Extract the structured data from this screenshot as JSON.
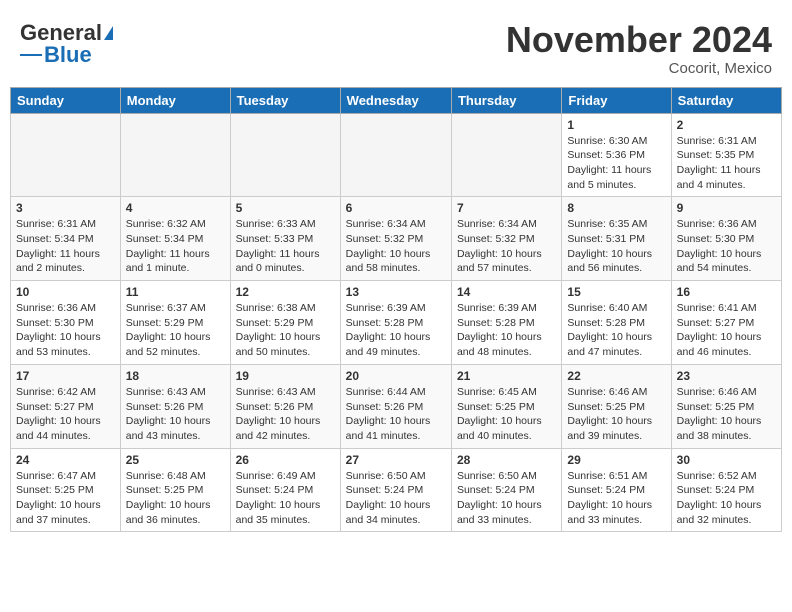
{
  "header": {
    "logo_general": "General",
    "logo_blue": "Blue",
    "month_title": "November 2024",
    "location": "Cocorit, Mexico"
  },
  "weekdays": [
    "Sunday",
    "Monday",
    "Tuesday",
    "Wednesday",
    "Thursday",
    "Friday",
    "Saturday"
  ],
  "weeks": [
    [
      {
        "day": "",
        "empty": true
      },
      {
        "day": "",
        "empty": true
      },
      {
        "day": "",
        "empty": true
      },
      {
        "day": "",
        "empty": true
      },
      {
        "day": "",
        "empty": true
      },
      {
        "day": "1",
        "sunrise": "6:30 AM",
        "sunset": "5:36 PM",
        "daylight": "11 hours and 5 minutes."
      },
      {
        "day": "2",
        "sunrise": "6:31 AM",
        "sunset": "5:35 PM",
        "daylight": "11 hours and 4 minutes."
      }
    ],
    [
      {
        "day": "3",
        "sunrise": "6:31 AM",
        "sunset": "5:34 PM",
        "daylight": "11 hours and 2 minutes."
      },
      {
        "day": "4",
        "sunrise": "6:32 AM",
        "sunset": "5:34 PM",
        "daylight": "11 hours and 1 minute."
      },
      {
        "day": "5",
        "sunrise": "6:33 AM",
        "sunset": "5:33 PM",
        "daylight": "11 hours and 0 minutes."
      },
      {
        "day": "6",
        "sunrise": "6:34 AM",
        "sunset": "5:32 PM",
        "daylight": "10 hours and 58 minutes."
      },
      {
        "day": "7",
        "sunrise": "6:34 AM",
        "sunset": "5:32 PM",
        "daylight": "10 hours and 57 minutes."
      },
      {
        "day": "8",
        "sunrise": "6:35 AM",
        "sunset": "5:31 PM",
        "daylight": "10 hours and 56 minutes."
      },
      {
        "day": "9",
        "sunrise": "6:36 AM",
        "sunset": "5:30 PM",
        "daylight": "10 hours and 54 minutes."
      }
    ],
    [
      {
        "day": "10",
        "sunrise": "6:36 AM",
        "sunset": "5:30 PM",
        "daylight": "10 hours and 53 minutes."
      },
      {
        "day": "11",
        "sunrise": "6:37 AM",
        "sunset": "5:29 PM",
        "daylight": "10 hours and 52 minutes."
      },
      {
        "day": "12",
        "sunrise": "6:38 AM",
        "sunset": "5:29 PM",
        "daylight": "10 hours and 50 minutes."
      },
      {
        "day": "13",
        "sunrise": "6:39 AM",
        "sunset": "5:28 PM",
        "daylight": "10 hours and 49 minutes."
      },
      {
        "day": "14",
        "sunrise": "6:39 AM",
        "sunset": "5:28 PM",
        "daylight": "10 hours and 48 minutes."
      },
      {
        "day": "15",
        "sunrise": "6:40 AM",
        "sunset": "5:28 PM",
        "daylight": "10 hours and 47 minutes."
      },
      {
        "day": "16",
        "sunrise": "6:41 AM",
        "sunset": "5:27 PM",
        "daylight": "10 hours and 46 minutes."
      }
    ],
    [
      {
        "day": "17",
        "sunrise": "6:42 AM",
        "sunset": "5:27 PM",
        "daylight": "10 hours and 44 minutes."
      },
      {
        "day": "18",
        "sunrise": "6:43 AM",
        "sunset": "5:26 PM",
        "daylight": "10 hours and 43 minutes."
      },
      {
        "day": "19",
        "sunrise": "6:43 AM",
        "sunset": "5:26 PM",
        "daylight": "10 hours and 42 minutes."
      },
      {
        "day": "20",
        "sunrise": "6:44 AM",
        "sunset": "5:26 PM",
        "daylight": "10 hours and 41 minutes."
      },
      {
        "day": "21",
        "sunrise": "6:45 AM",
        "sunset": "5:25 PM",
        "daylight": "10 hours and 40 minutes."
      },
      {
        "day": "22",
        "sunrise": "6:46 AM",
        "sunset": "5:25 PM",
        "daylight": "10 hours and 39 minutes."
      },
      {
        "day": "23",
        "sunrise": "6:46 AM",
        "sunset": "5:25 PM",
        "daylight": "10 hours and 38 minutes."
      }
    ],
    [
      {
        "day": "24",
        "sunrise": "6:47 AM",
        "sunset": "5:25 PM",
        "daylight": "10 hours and 37 minutes."
      },
      {
        "day": "25",
        "sunrise": "6:48 AM",
        "sunset": "5:25 PM",
        "daylight": "10 hours and 36 minutes."
      },
      {
        "day": "26",
        "sunrise": "6:49 AM",
        "sunset": "5:24 PM",
        "daylight": "10 hours and 35 minutes."
      },
      {
        "day": "27",
        "sunrise": "6:50 AM",
        "sunset": "5:24 PM",
        "daylight": "10 hours and 34 minutes."
      },
      {
        "day": "28",
        "sunrise": "6:50 AM",
        "sunset": "5:24 PM",
        "daylight": "10 hours and 33 minutes."
      },
      {
        "day": "29",
        "sunrise": "6:51 AM",
        "sunset": "5:24 PM",
        "daylight": "10 hours and 33 minutes."
      },
      {
        "day": "30",
        "sunrise": "6:52 AM",
        "sunset": "5:24 PM",
        "daylight": "10 hours and 32 minutes."
      }
    ]
  ],
  "labels": {
    "sunrise": "Sunrise:",
    "sunset": "Sunset:",
    "daylight": "Daylight:"
  }
}
